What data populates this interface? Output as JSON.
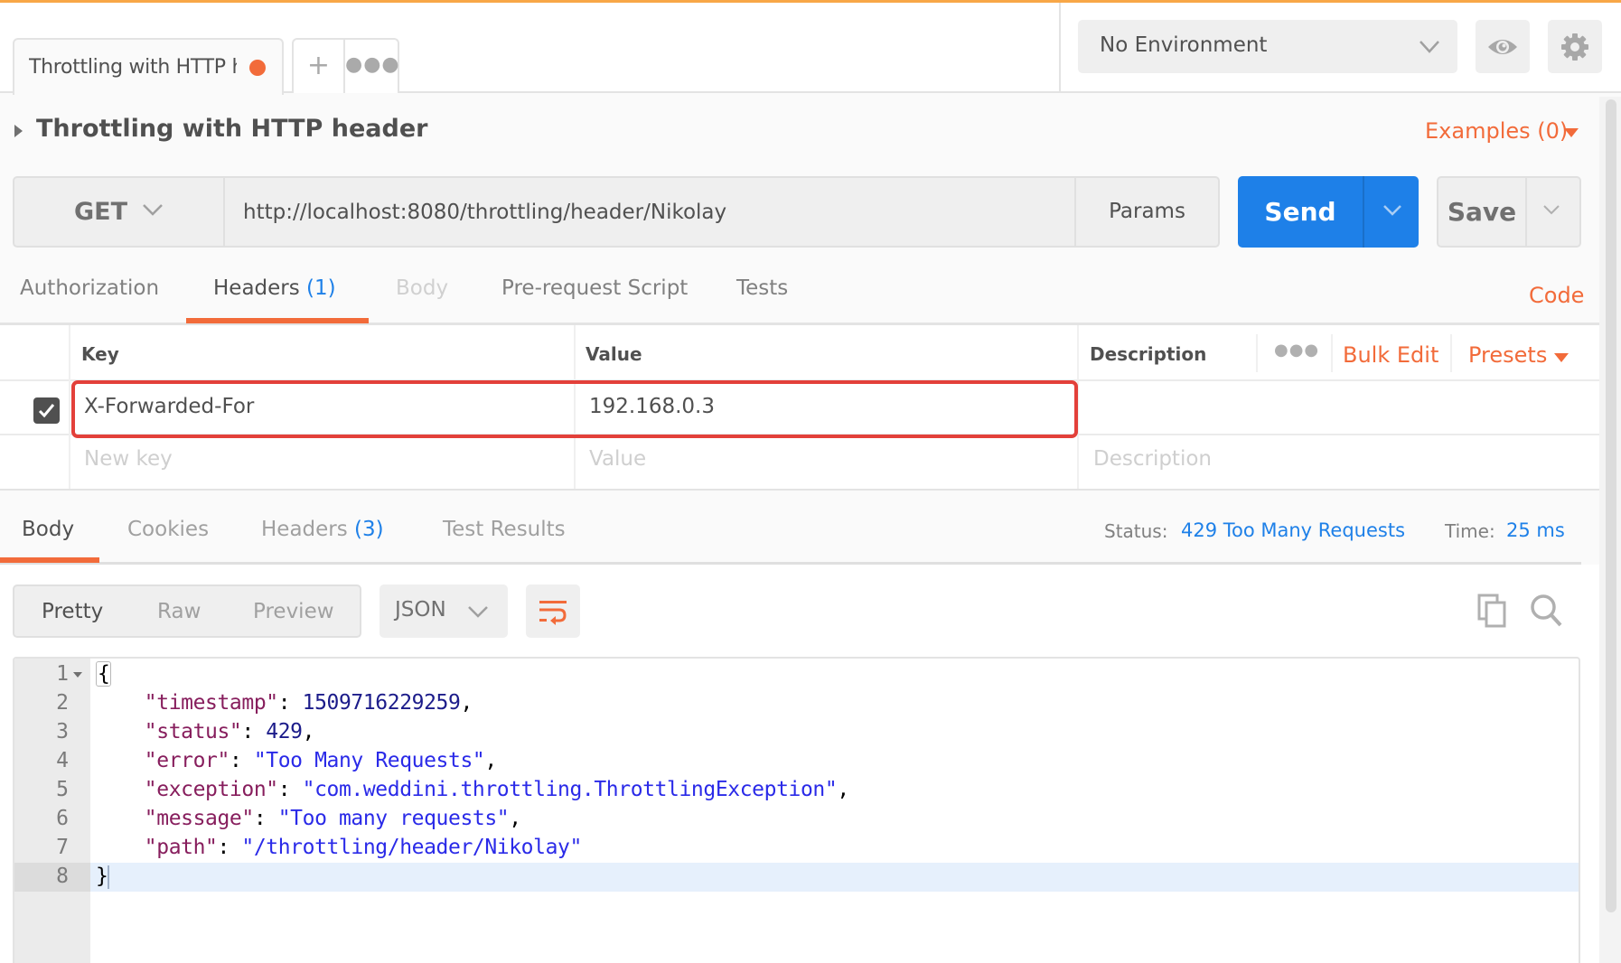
{
  "tabs": {
    "active": {
      "title": "Throttling with HTTP header",
      "unsaved_dot_color": "#f26b3a"
    },
    "add_icon": "plus-icon",
    "more_icon": "ellipsis-icon"
  },
  "environment": {
    "selected": "No Environment",
    "eye_icon": "eye-icon",
    "settings_icon": "gear-icon"
  },
  "request": {
    "title": "Throttling with HTTP header",
    "examples_label": "Examples (0)",
    "method": "GET",
    "url": "http://localhost:8080/throttling/header/Nikolay",
    "params_label": "Params",
    "send_label": "Send",
    "save_label": "Save",
    "code_label": "Code",
    "tabs": [
      {
        "label": "Authorization",
        "count": "",
        "state": "normal"
      },
      {
        "label": "Headers",
        "count": "(1)",
        "state": "active"
      },
      {
        "label": "Body",
        "count": "",
        "state": "disabled"
      },
      {
        "label": "Pre-request Script",
        "count": "",
        "state": "normal"
      },
      {
        "label": "Tests",
        "count": "",
        "state": "normal"
      }
    ]
  },
  "headers_table": {
    "columns": {
      "key": "Key",
      "value": "Value",
      "description": "Description"
    },
    "bulk_edit_label": "Bulk Edit",
    "presets_label": "Presets",
    "rows": [
      {
        "enabled": true,
        "key": "X-Forwarded-For",
        "value": "192.168.0.3",
        "description": ""
      }
    ],
    "new_row_placeholders": {
      "key": "New key",
      "value": "Value",
      "description": "Description"
    }
  },
  "response": {
    "tabs": [
      {
        "label": "Body",
        "count": "",
        "state": "active"
      },
      {
        "label": "Cookies",
        "count": "",
        "state": "normal"
      },
      {
        "label": "Headers",
        "count": "(3)",
        "state": "normal"
      },
      {
        "label": "Test Results",
        "count": "",
        "state": "normal"
      }
    ],
    "status_label": "Status:",
    "status_value": "429 Too Many Requests",
    "time_label": "Time:",
    "time_value": "25 ms",
    "view_modes": [
      "Pretty",
      "Raw",
      "Preview"
    ],
    "active_view": "Pretty",
    "format": "JSON",
    "body_lines": [
      {
        "n": "1",
        "fold": true,
        "tokens": [
          {
            "t": "{",
            "c": "brace"
          }
        ]
      },
      {
        "n": "2",
        "tokens": [
          {
            "t": "    ",
            "c": "punct"
          },
          {
            "t": "\"timestamp\"",
            "c": "key"
          },
          {
            "t": ": ",
            "c": "punct"
          },
          {
            "t": "1509716229259",
            "c": "num"
          },
          {
            "t": ",",
            "c": "punct"
          }
        ]
      },
      {
        "n": "3",
        "tokens": [
          {
            "t": "    ",
            "c": "punct"
          },
          {
            "t": "\"status\"",
            "c": "key"
          },
          {
            "t": ": ",
            "c": "punct"
          },
          {
            "t": "429",
            "c": "num"
          },
          {
            "t": ",",
            "c": "punct"
          }
        ]
      },
      {
        "n": "4",
        "tokens": [
          {
            "t": "    ",
            "c": "punct"
          },
          {
            "t": "\"error\"",
            "c": "key"
          },
          {
            "t": ": ",
            "c": "punct"
          },
          {
            "t": "\"Too Many Requests\"",
            "c": "str"
          },
          {
            "t": ",",
            "c": "punct"
          }
        ]
      },
      {
        "n": "5",
        "tokens": [
          {
            "t": "    ",
            "c": "punct"
          },
          {
            "t": "\"exception\"",
            "c": "key"
          },
          {
            "t": ": ",
            "c": "punct"
          },
          {
            "t": "\"com.weddini.throttling.ThrottlingException\"",
            "c": "str"
          },
          {
            "t": ",",
            "c": "punct"
          }
        ]
      },
      {
        "n": "6",
        "tokens": [
          {
            "t": "    ",
            "c": "punct"
          },
          {
            "t": "\"message\"",
            "c": "key"
          },
          {
            "t": ": ",
            "c": "punct"
          },
          {
            "t": "\"Too many requests\"",
            "c": "str"
          },
          {
            "t": ",",
            "c": "punct"
          }
        ]
      },
      {
        "n": "7",
        "tokens": [
          {
            "t": "    ",
            "c": "punct"
          },
          {
            "t": "\"path\"",
            "c": "key"
          },
          {
            "t": ": ",
            "c": "punct"
          },
          {
            "t": "\"/throttling/header/Nikolay\"",
            "c": "str"
          }
        ]
      },
      {
        "n": "8",
        "active": true,
        "tokens": [
          {
            "t": "}",
            "c": "punct"
          }
        ]
      }
    ]
  },
  "colors": {
    "accent_orange": "#f26b3a",
    "primary_blue": "#1e80e8",
    "highlight_red": "#e3403a"
  }
}
